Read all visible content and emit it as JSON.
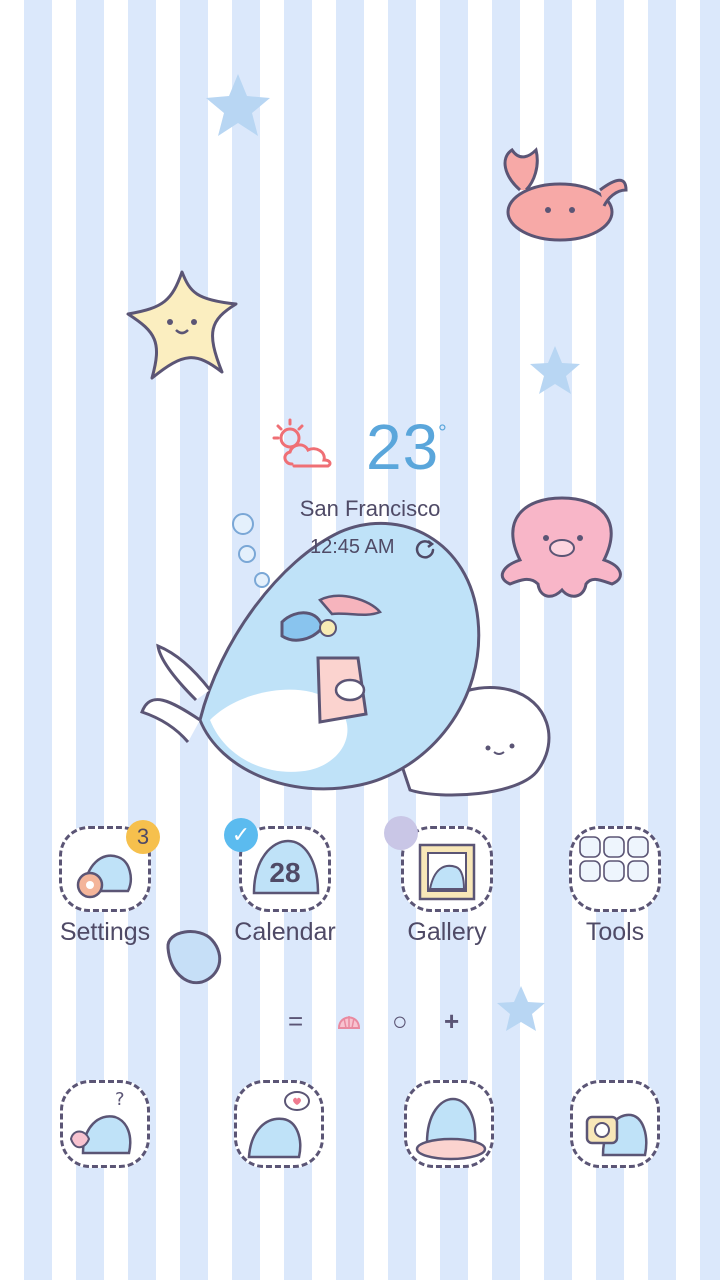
{
  "weather": {
    "temperature": "23",
    "unit": "°",
    "city": "San Francisco",
    "time": "12:45 AM",
    "condition_icon": "sun-cloud-icon"
  },
  "apps": [
    {
      "label": "Settings",
      "badge": "3"
    },
    {
      "label": "Calendar",
      "calendar_day": "28",
      "badge_icon": "check-icon"
    },
    {
      "label": "Gallery"
    },
    {
      "label": "Tools"
    }
  ],
  "page_indicator": {
    "items": [
      "=",
      "shell-icon",
      "○",
      "+"
    ],
    "active_index": 1
  },
  "dock": [
    {
      "name": "phone",
      "icon": "question-shark-icon"
    },
    {
      "name": "messages",
      "icon": "heart-bubble-shark-icon"
    },
    {
      "name": "browser",
      "icon": "float-ring-shark-icon"
    },
    {
      "name": "camera",
      "icon": "camera-shark-icon"
    }
  ],
  "colors": {
    "stripe_light": "#dbe8fb",
    "accent_blue": "#5aa6db",
    "text": "#4f4a66",
    "badge_orange": "#f6c04d",
    "badge_check": "#5bbbef"
  }
}
